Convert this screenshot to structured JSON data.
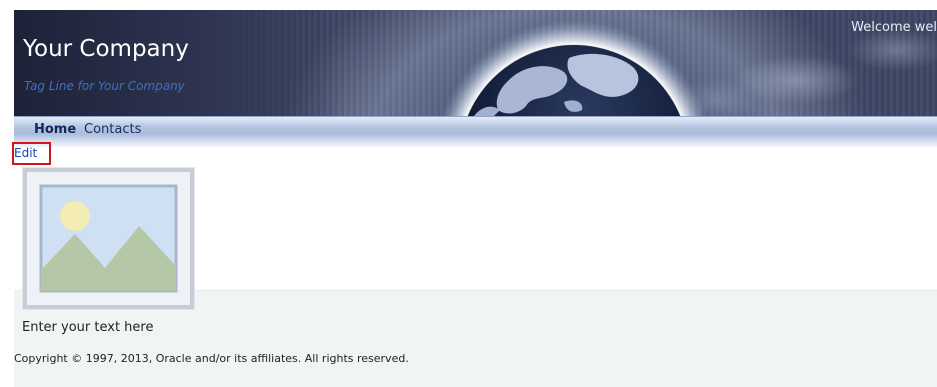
{
  "header": {
    "company_name": "Your Company",
    "tagline": "Tag Line for Your Company",
    "welcome_text": "Welcome wel"
  },
  "nav": {
    "items": [
      {
        "label": "Home",
        "active": true
      },
      {
        "label": "Contacts",
        "active": false
      }
    ]
  },
  "toolbar": {
    "edit_label": "Edit"
  },
  "content": {
    "image_icon": "image-placeholder-icon",
    "text": "Enter your text here"
  },
  "footer": {
    "copyright": "Copyright © 1997, 2013, Oracle and/or its affiliates. All rights reserved."
  },
  "colors": {
    "banner_dark": "#1d2238",
    "tagline": "#3f6fc2",
    "nav_text": "#12285a",
    "edit_link": "#1a44b8",
    "highlight_border": "#d4141b",
    "content_bg": "#f0f5f3"
  }
}
